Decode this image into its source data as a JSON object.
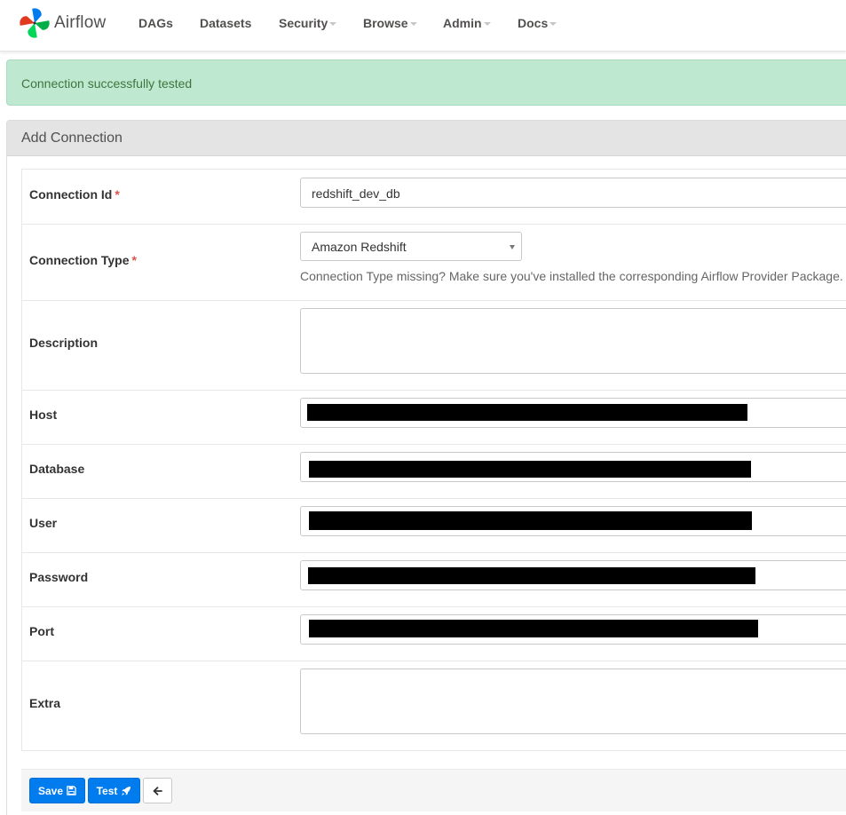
{
  "navbar": {
    "brand": "Airflow",
    "items": [
      {
        "label": "DAGs",
        "dropdown": false
      },
      {
        "label": "Datasets",
        "dropdown": false
      },
      {
        "label": "Security",
        "dropdown": true
      },
      {
        "label": "Browse",
        "dropdown": true
      },
      {
        "label": "Admin",
        "dropdown": true
      },
      {
        "label": "Docs",
        "dropdown": true
      }
    ]
  },
  "alert": {
    "message": "Connection successfully tested",
    "color": "#3c763d",
    "background": "#bfe8d0"
  },
  "panel": {
    "title": "Add Connection"
  },
  "form": {
    "connection_id": {
      "label": "Connection Id",
      "required_mark": "*",
      "value": "redshift_dev_db"
    },
    "connection_type": {
      "label": "Connection Type",
      "required_mark": "*",
      "value": "Amazon Redshift",
      "help": "Connection Type missing? Make sure you've installed the corresponding Airflow Provider Package."
    },
    "description": {
      "label": "Description",
      "value": ""
    },
    "host": {
      "label": "Host",
      "redacted": true
    },
    "database": {
      "label": "Database",
      "redacted": true
    },
    "user": {
      "label": "User",
      "redacted": true
    },
    "password": {
      "label": "Password",
      "redacted": true
    },
    "port": {
      "label": "Port",
      "redacted": true
    },
    "extra": {
      "label": "Extra",
      "value": ""
    }
  },
  "buttons": {
    "save": {
      "label": "Save",
      "icon": "floppy-disk-icon"
    },
    "test": {
      "label": "Test",
      "icon": "rocket-icon"
    },
    "back": {
      "icon": "arrow-left-icon"
    }
  },
  "colors": {
    "primary": "#017cee",
    "required": "#d9534f"
  }
}
